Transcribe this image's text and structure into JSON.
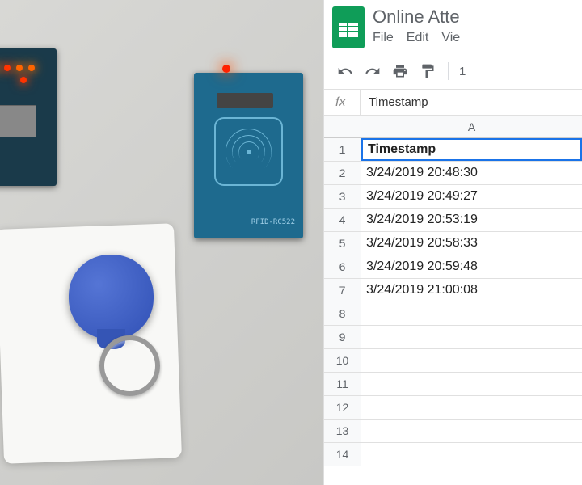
{
  "doc": {
    "title": "Online Atte",
    "menu": {
      "file": "File",
      "edit": "Edit",
      "view": "Vie"
    },
    "zoom_partial": "1",
    "formula": {
      "fx": "fx",
      "value": "Timestamp"
    },
    "column_a": "A",
    "rfid_label": "RFID-RC522"
  },
  "rows": [
    {
      "n": "1",
      "val": "Timestamp"
    },
    {
      "n": "2",
      "val": "3/24/2019 20:48:30"
    },
    {
      "n": "3",
      "val": "3/24/2019 20:49:27"
    },
    {
      "n": "4",
      "val": "3/24/2019 20:53:19"
    },
    {
      "n": "5",
      "val": "3/24/2019 20:58:33"
    },
    {
      "n": "6",
      "val": "3/24/2019 20:59:48"
    },
    {
      "n": "7",
      "val": "3/24/2019 21:00:08"
    },
    {
      "n": "8",
      "val": ""
    },
    {
      "n": "9",
      "val": ""
    },
    {
      "n": "10",
      "val": ""
    },
    {
      "n": "11",
      "val": ""
    },
    {
      "n": "12",
      "val": ""
    },
    {
      "n": "13",
      "val": ""
    },
    {
      "n": "14",
      "val": ""
    }
  ]
}
